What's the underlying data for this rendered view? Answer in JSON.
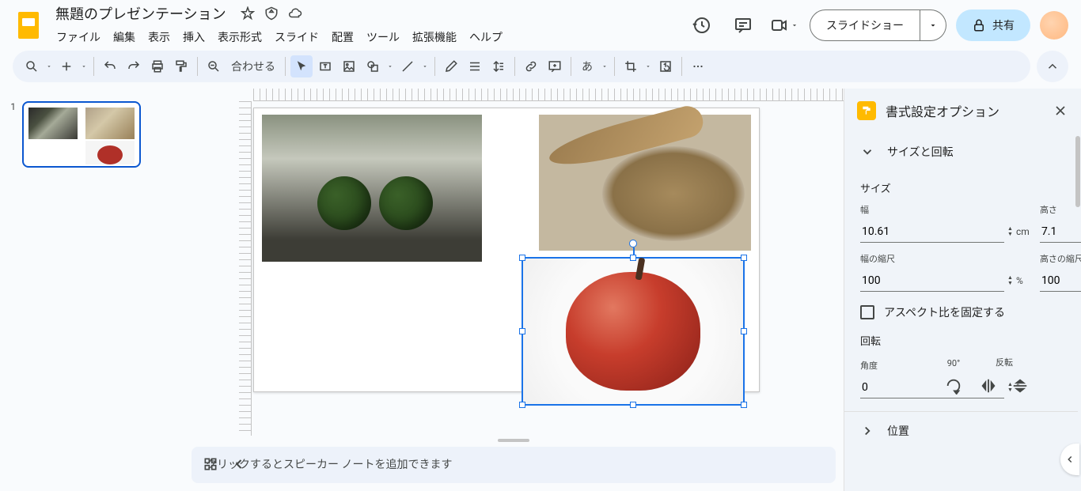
{
  "header": {
    "title": "無題のプレゼンテーション",
    "menus": [
      "ファイル",
      "編集",
      "表示",
      "挿入",
      "表示形式",
      "スライド",
      "配置",
      "ツール",
      "拡張機能",
      "ヘルプ"
    ],
    "slideshow": "スライドショー",
    "share": "共有"
  },
  "toolbar": {
    "zoom": "合わせる"
  },
  "slides": {
    "items": [
      {
        "number": "1"
      }
    ]
  },
  "notes": {
    "placeholder": "クリックするとスピーカー ノートを追加できます"
  },
  "sidebar": {
    "title": "書式設定オプション",
    "sections": {
      "size_rotation": {
        "label": "サイズと回転",
        "size_label": "サイズ",
        "width_label": "幅",
        "height_label": "高さ",
        "width_val": "10.61",
        "height_val": "7.1",
        "unit_cm": "cm",
        "width_scale_label": "幅の縮尺",
        "height_scale_label": "高さの縮尺",
        "width_scale_val": "100",
        "height_scale_val": "100",
        "unit_pct": "%",
        "lock_aspect": "アスペクト比を固定する",
        "rotation_label": "回転",
        "angle_label": "角度",
        "angle_val": "0",
        "unit_deg": "°",
        "ninety_label": "90°",
        "flip_label": "反転"
      },
      "position": {
        "label": "位置"
      }
    }
  }
}
